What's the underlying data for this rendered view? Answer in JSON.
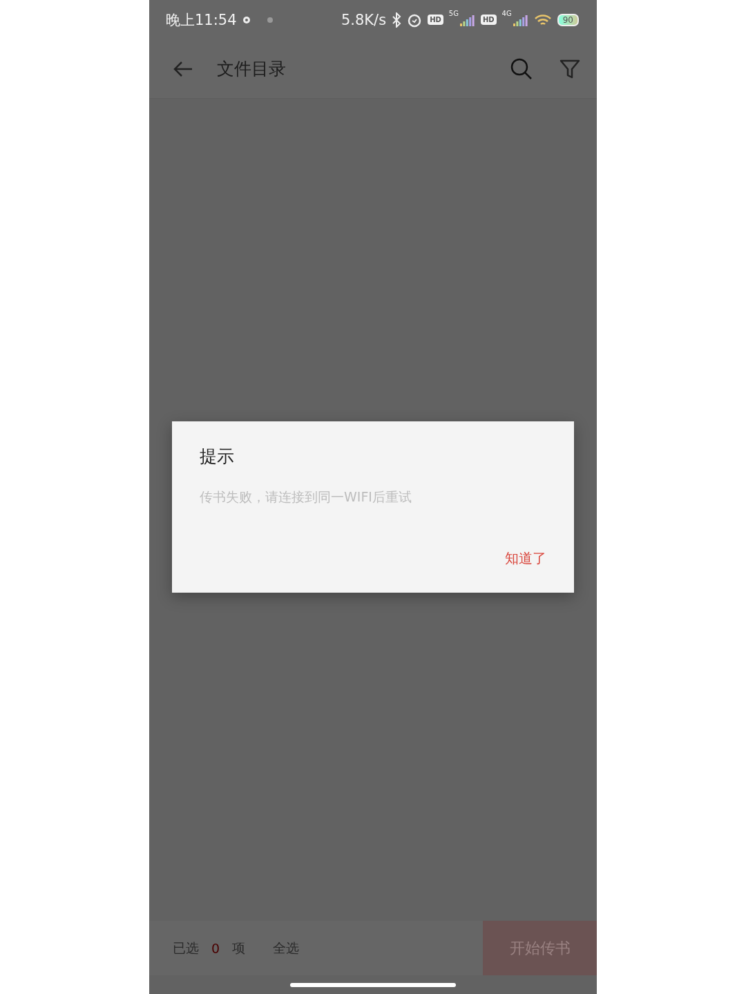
{
  "status_bar": {
    "time": "晚上11:54",
    "network_speed": "5.8K/s",
    "sims": [
      {
        "badge": "HD",
        "network": "5G"
      },
      {
        "badge": "HD",
        "network": "4G"
      }
    ],
    "battery": "90"
  },
  "app_bar": {
    "title": "文件目录"
  },
  "dialog": {
    "title": "提示",
    "message": "传书失败，请连接到同一WIFI后重试",
    "button": "知道了"
  },
  "bottom_bar": {
    "selected_prefix": "已选",
    "selected_count": "0",
    "selected_suffix": "项",
    "select_all": "全选",
    "start_button": {
      "label": "开始传书",
      "disabled": true
    }
  }
}
